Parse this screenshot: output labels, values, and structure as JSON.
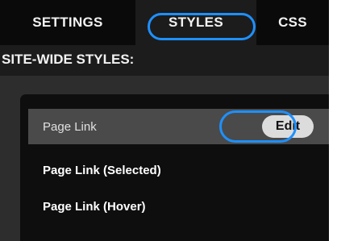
{
  "tabs": [
    {
      "label": "SETTINGS"
    },
    {
      "label": "STYLES"
    },
    {
      "label": "CSS"
    }
  ],
  "active_tab": "STYLES",
  "section": {
    "heading": "SITE-WIDE STYLES:"
  },
  "styles_list": {
    "items": [
      {
        "label": "Page Link",
        "highlighted": true
      },
      {
        "label": "Page Link (Selected)",
        "highlighted": false
      },
      {
        "label": "Page Link (Hover)",
        "highlighted": false
      }
    ],
    "edit_label": "Edit"
  },
  "colors": {
    "tab_bar_bg": "#0a0a0a",
    "active_tab_bg": "#1c1c1c",
    "panel_bg": "#2d2d2d",
    "list_bg": "#0e0e0e",
    "highlight_row_bg": "#4a4a4a",
    "focus_ring": "#1e90ff",
    "edit_button_bg": "#dcdcdc"
  }
}
